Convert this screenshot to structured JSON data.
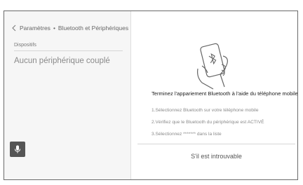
{
  "breadcrumb": {
    "parent": "Paramètres",
    "separator": "•",
    "current": "Bluetooth et Périphériques"
  },
  "devices": {
    "section_label": "Dispositifs",
    "empty_message": "Aucun périphérique couplé"
  },
  "pairing": {
    "instruction": "Terminez l'appariement Bluetooth à l'aide du téléphone mobile.",
    "steps": [
      "1.Sélectionnez Bluetooth sur votre téléphone mobile",
      "2.Vérifiez que le Bluetooth du périphérique est ACTIVÉ",
      "3.Sélectionnez ******* dans la liste"
    ],
    "not_found_label": "S'il est introuvable"
  },
  "icons": {
    "back": "chevron-left-icon",
    "illustration": "hand-holding-phone-bluetooth-icon",
    "mic": "microphone-icon"
  },
  "colors": {
    "left_panel_bg": "#f6f6f6",
    "mic_button_bg": "#555555",
    "border": "#6a6a6a"
  }
}
